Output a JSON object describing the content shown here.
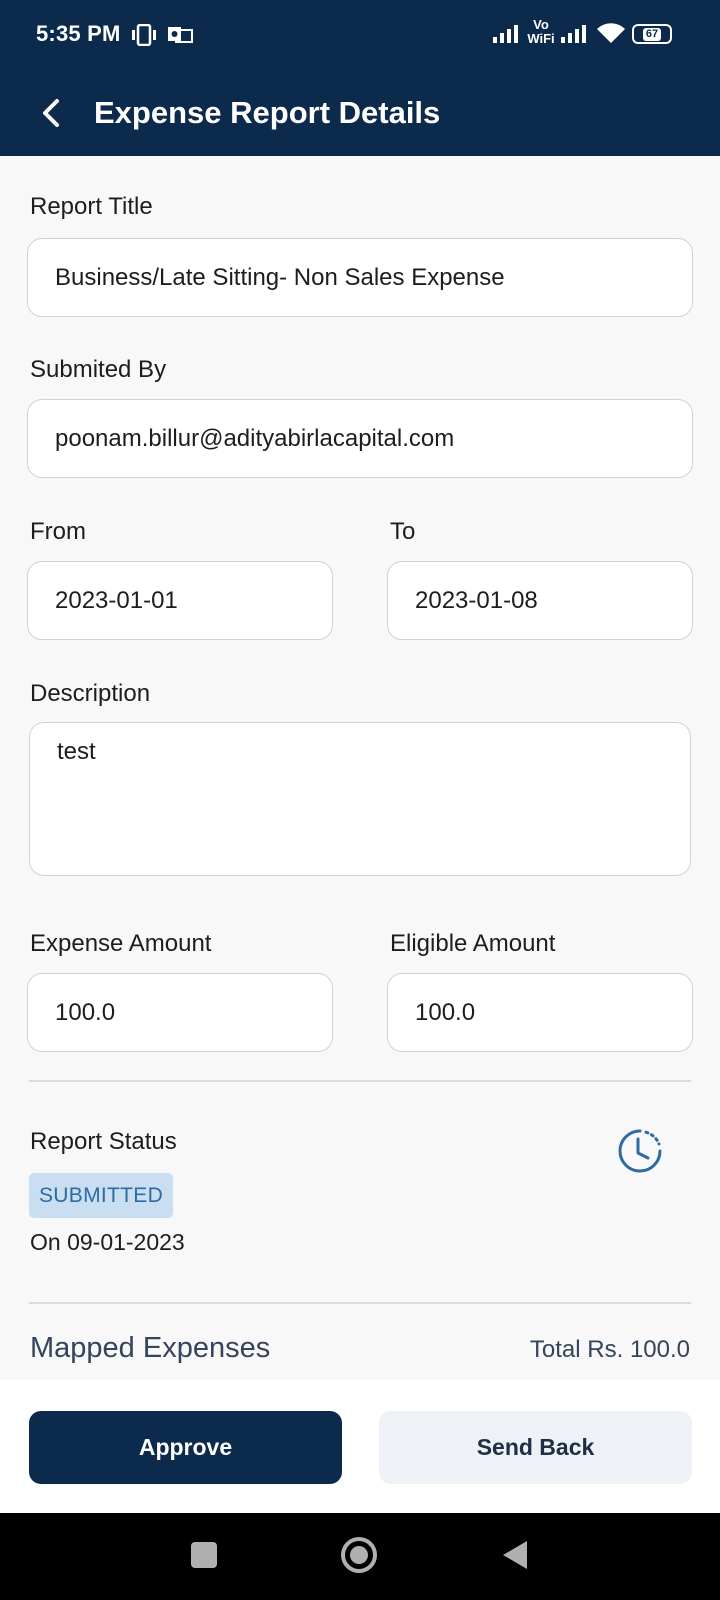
{
  "status_bar": {
    "time": "5:35 PM",
    "icons": [
      "vibrate-icon",
      "outlook-icon",
      "signal-icon",
      "vowifi-icon",
      "signal-icon",
      "wifi-icon",
      "battery-icon"
    ],
    "vowifi_top": "Vo",
    "vowifi_bottom": "WiFi",
    "battery": "67"
  },
  "app_bar": {
    "title": "Expense Report Details",
    "back_icon": "chevron-left-icon",
    "background": "#0c2a4b"
  },
  "form": {
    "report_title": {
      "label": "Report Title",
      "value": "Business/Late Sitting- Non Sales Expense"
    },
    "submitted_by": {
      "label": "Submited By",
      "value": "poonam.billur@adityabirlacapital.com"
    },
    "from": {
      "label": "From",
      "value": "2023-01-01"
    },
    "to": {
      "label": "To",
      "value": "2023-01-08"
    },
    "description": {
      "label": "Description",
      "value": "test"
    },
    "expense_amount": {
      "label": "Expense Amount",
      "value": "100.0"
    },
    "eligible_amount": {
      "label": "Eligible Amount",
      "value": "100.0"
    }
  },
  "report_status": {
    "label": "Report Status",
    "badge": "SUBMITTED",
    "date": "On 09-01-2023",
    "icon": "clock-history-icon"
  },
  "mapped_expenses": {
    "title": "Mapped Expenses",
    "total": "Total Rs. 100.0"
  },
  "actions": {
    "approve": "Approve",
    "send_back": "Send Back"
  },
  "nav_bar": {
    "icons": [
      "recents-icon",
      "home-icon",
      "back-icon"
    ]
  }
}
